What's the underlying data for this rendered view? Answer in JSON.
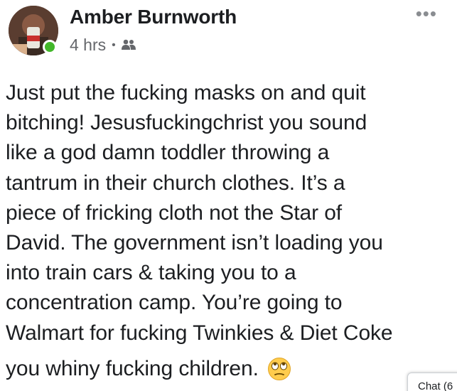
{
  "post": {
    "author": "Amber Burnworth",
    "timestamp": "4 hrs",
    "separator": "•",
    "audience_icon": "friends-icon",
    "more_icon": "more-options-icon",
    "more_label": "•••",
    "lines": [
      "Just put the fucking masks on and quit",
      "bitching! Jesusfuckingchrist you sound",
      "like a god damn toddler throwing a",
      "tantrum in their church clothes. It’s a",
      "piece of fricking cloth not the Star of",
      "David. The government isn’t loading you",
      "into train cars & taking you to a",
      "concentration camp. You’re going to",
      "Walmart for fucking Twinkies & Diet Coke",
      "you whiny fucking children."
    ],
    "emoji": "eye-roll-emoji",
    "online_color": "#42b72a"
  },
  "chat": {
    "label": "Chat (6"
  }
}
